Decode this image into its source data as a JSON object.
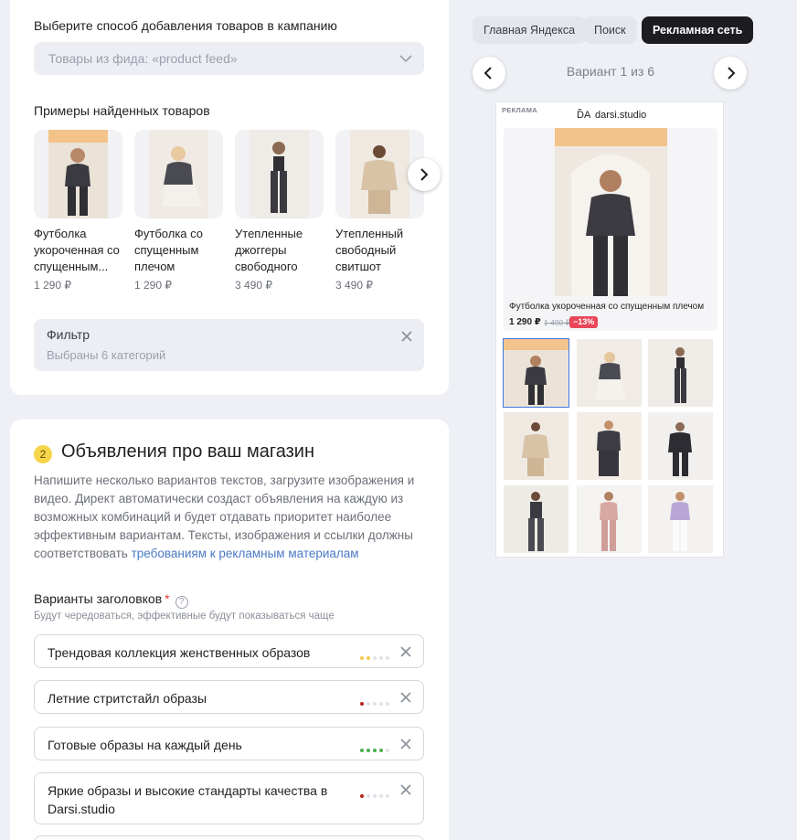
{
  "left": {
    "method_label": "Выберите способ добавления товаров в кампанию",
    "method_value": "Товары из фида: «product feed»",
    "examples_label": "Примеры найденных товаров",
    "products": [
      {
        "name": "Футболка укороченная со спущенным...",
        "price": "1 290 ₽"
      },
      {
        "name": "Футболка со спущенным плечом",
        "price": "1 290 ₽"
      },
      {
        "name": "Утепленные джоггеры свободного кро...",
        "price": "3 490 ₽"
      },
      {
        "name": "Утепленный свободный свитшот цвета...",
        "price": "3 490 ₽"
      }
    ],
    "filter": {
      "title": "Фильтр",
      "subtitle": "Выбраны 6 категорий"
    },
    "step_number": "2",
    "section_title": "Объявления про ваш магазин",
    "description": "Напишите несколько вариантов текстов, загрузите изображения и видео. Директ автоматически создаст объявления на каждую из возможных комбинаций и будет отдавать приоритет наиболее эффективным вариантам. Тексты, изображения и ссылки должны соответствовать ",
    "description_link": "требованиям к рекламным материалам",
    "headlines_label": "Варианты заголовков",
    "required_mark": "*",
    "help_mark": "?",
    "headlines_hint": "Будут чередоваться, эффективные будут показываться чаще",
    "headlines": [
      {
        "text": "Трендовая коллекция женственных образов",
        "rating": 2,
        "color": "#f2c94c"
      },
      {
        "text": "Летние стритстайл образы",
        "rating": 1,
        "color": "#b3261e"
      },
      {
        "text": "Готовые образы на каждый день",
        "rating": 4,
        "color": "#4caf50"
      },
      {
        "text": "Яркие образы и высокие стандарты качества в Darsi.studio",
        "rating": 1,
        "color": "#b3261e"
      }
    ]
  },
  "right": {
    "tabs": [
      "Главная Яндекса",
      "Поиск",
      "Рекламная сеть"
    ],
    "active_tab": "Рекламная сеть",
    "variant_text": "Вариант 1 из 6",
    "ad": {
      "label": "РЕКЛАМА",
      "logo": "D̃A",
      "brand": "darsi.studio",
      "product_title": "Футболка укороченная со спущенным плечом",
      "price": "1 290 ₽",
      "old_price": "1 490 ₽",
      "discount": "−13%"
    }
  },
  "icons": [
    "chevron-down-icon",
    "chevron-right-icon",
    "chevron-left-icon",
    "close-icon"
  ],
  "colors": {
    "accent_link": "#4a79c5",
    "step_badge": "#f7d54a",
    "active_tab": "#1c1c21",
    "discount": "#e94759"
  }
}
